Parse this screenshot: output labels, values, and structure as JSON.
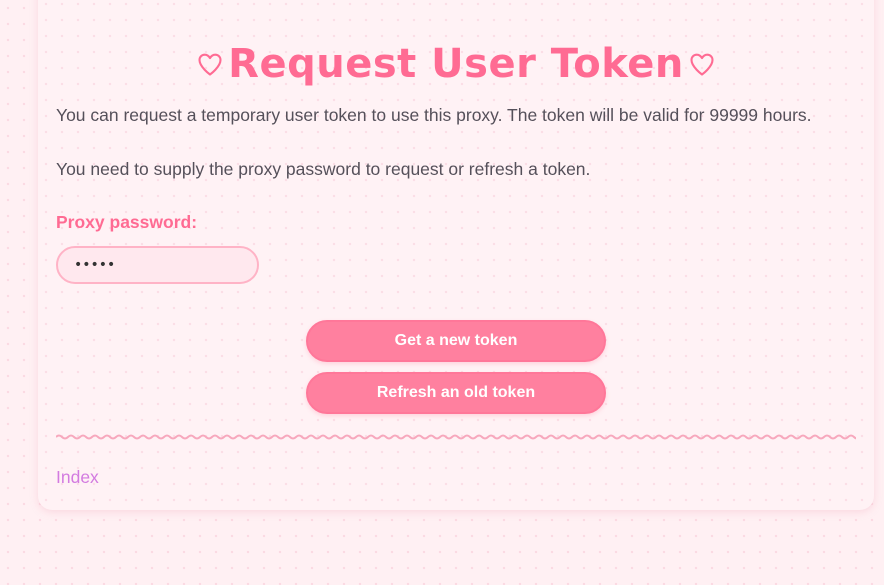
{
  "page": {
    "title": "Request User Token",
    "intro_text": "You can request a temporary user token to use this proxy. The token will be valid for 99999 hours.",
    "password_note": "You need to supply the proxy password to request or refresh a token."
  },
  "form": {
    "password_label": "Proxy password:",
    "password_value": "•••••",
    "buttons": {
      "new_token": "Get a new token",
      "refresh_token": "Refresh an old token"
    }
  },
  "footer": {
    "index_link": "Index"
  },
  "icons": {
    "title_left": "heart-outline-icon",
    "title_right": "heart-outline-icon"
  },
  "colors": {
    "accent": "#ff6b93",
    "button_bg": "#ff809f",
    "link": "#d37be0",
    "background": "#fff0f3"
  }
}
